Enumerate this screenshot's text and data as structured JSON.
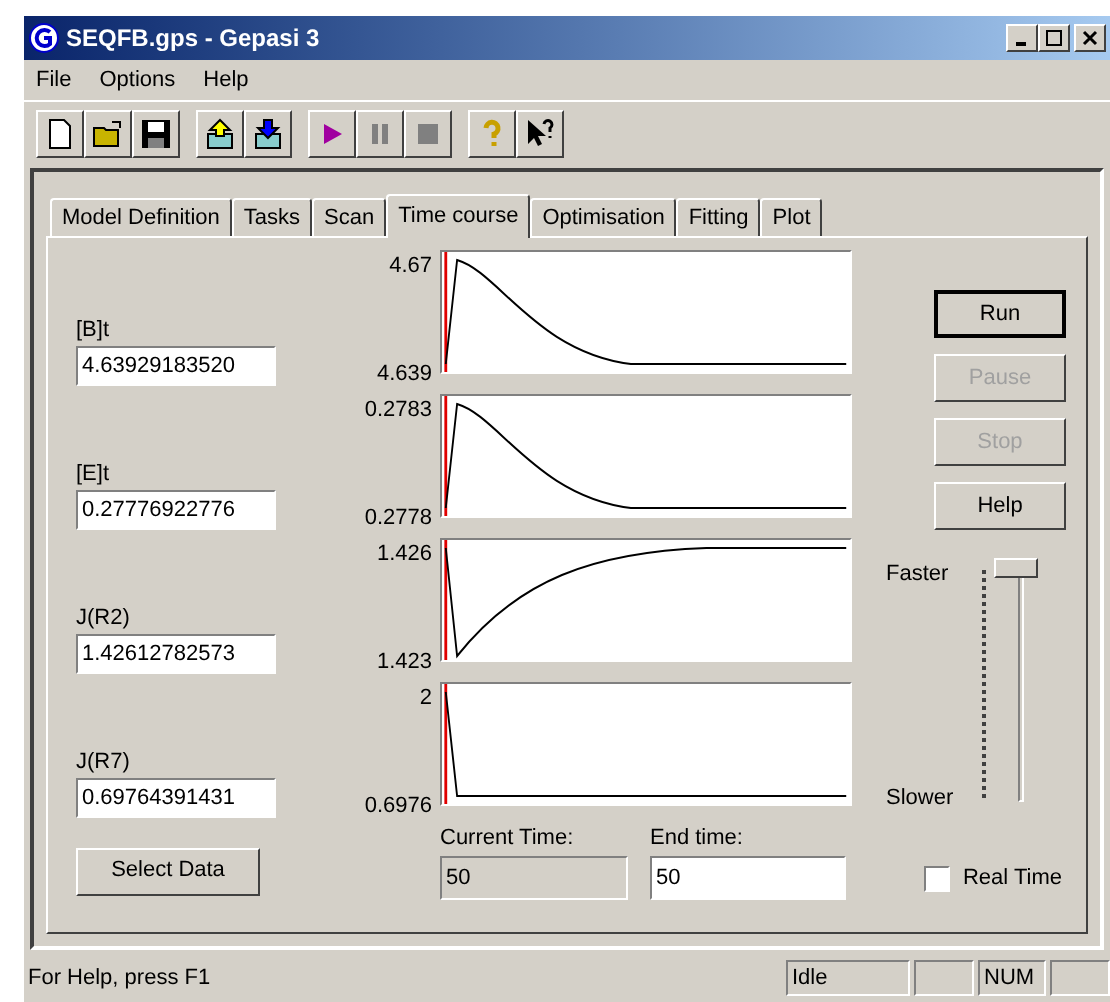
{
  "window": {
    "title": "SEQFB.gps - Gepasi 3"
  },
  "menu": [
    "File",
    "Options",
    "Help"
  ],
  "tabs": [
    {
      "label": "Model Definition",
      "selected": false
    },
    {
      "label": "Tasks",
      "selected": false
    },
    {
      "label": "Scan",
      "selected": false
    },
    {
      "label": "Time course",
      "selected": true
    },
    {
      "label": "Optimisation",
      "selected": false
    },
    {
      "label": "Fitting",
      "selected": false
    },
    {
      "label": "Plot",
      "selected": false
    }
  ],
  "variables": [
    {
      "label": "[B]t",
      "value": "4.63929183520",
      "ymax": "4.67",
      "ymin": "4.639",
      "kind": "peak"
    },
    {
      "label": "[E]t",
      "value": "0.27776922776",
      "ymax": "0.2783",
      "ymin": "0.2778",
      "kind": "peak"
    },
    {
      "label": "J(R2)",
      "value": "1.42612782573",
      "ymax": "1.426",
      "ymin": "1.423",
      "kind": "dip"
    },
    {
      "label": "J(R7)",
      "value": "0.69764391431",
      "ymax": "2",
      "ymin": "0.6976",
      "kind": "drop"
    }
  ],
  "select_data_button": "Select Data",
  "current_time": {
    "label": "Current Time:",
    "value": "50"
  },
  "end_time": {
    "label": "End time:",
    "value": "50"
  },
  "buttons": [
    {
      "label": "Run",
      "default": true,
      "disabled": false
    },
    {
      "label": "Pause",
      "default": false,
      "disabled": true
    },
    {
      "label": "Stop",
      "default": false,
      "disabled": true
    },
    {
      "label": "Help",
      "default": false,
      "disabled": false
    }
  ],
  "speed_slider": {
    "top_label": "Faster",
    "bottom_label": "Slower",
    "level": 1
  },
  "real_time": {
    "label": "Real Time",
    "checked": false
  },
  "status_bar": {
    "message": "For Help, press F1",
    "panes": [
      {
        "kind": "text",
        "text": "Idle"
      },
      {
        "kind": "blank"
      },
      {
        "kind": "text",
        "text": "NUM"
      },
      {
        "kind": "blank"
      }
    ]
  }
}
